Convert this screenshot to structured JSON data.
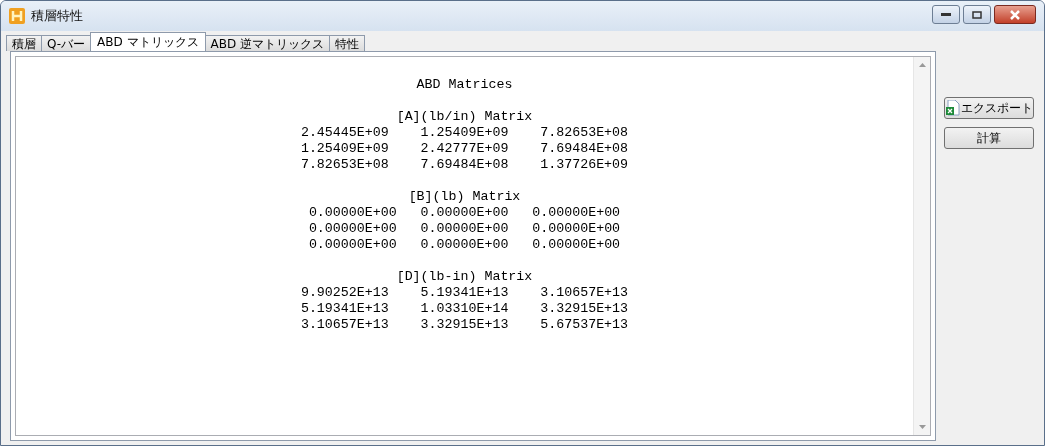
{
  "window": {
    "title": "積層特性"
  },
  "tabs": [
    {
      "label": "積層",
      "selected": false
    },
    {
      "label": "Q-バー",
      "selected": false
    },
    {
      "label": "ABD マトリックス",
      "selected": true
    },
    {
      "label": "ABD 逆マトリックス",
      "selected": false
    },
    {
      "label": "特性",
      "selected": false
    }
  ],
  "report": {
    "title": "ABD Matrices",
    "sections": [
      {
        "heading": "[A](lb/in) Matrix",
        "rows": [
          "2.45445E+09    1.25409E+09    7.82653E+08",
          "1.25409E+09    2.42777E+09    7.69484E+08",
          "7.82653E+08    7.69484E+08    1.37726E+09"
        ]
      },
      {
        "heading": "[B](lb) Matrix",
        "rows": [
          "0.00000E+00   0.00000E+00   0.00000E+00",
          "0.00000E+00   0.00000E+00   0.00000E+00",
          "0.00000E+00   0.00000E+00   0.00000E+00"
        ]
      },
      {
        "heading": "[D](lb-in) Matrix",
        "rows": [
          "9.90252E+13    5.19341E+13    3.10657E+13",
          "5.19341E+13    1.03310E+14    3.32915E+13",
          "3.10657E+13    3.32915E+13    5.67537E+13"
        ]
      }
    ]
  },
  "buttons": [
    {
      "label": "エクスポート",
      "kind": "export"
    },
    {
      "label": "計算",
      "kind": "plain"
    }
  ]
}
